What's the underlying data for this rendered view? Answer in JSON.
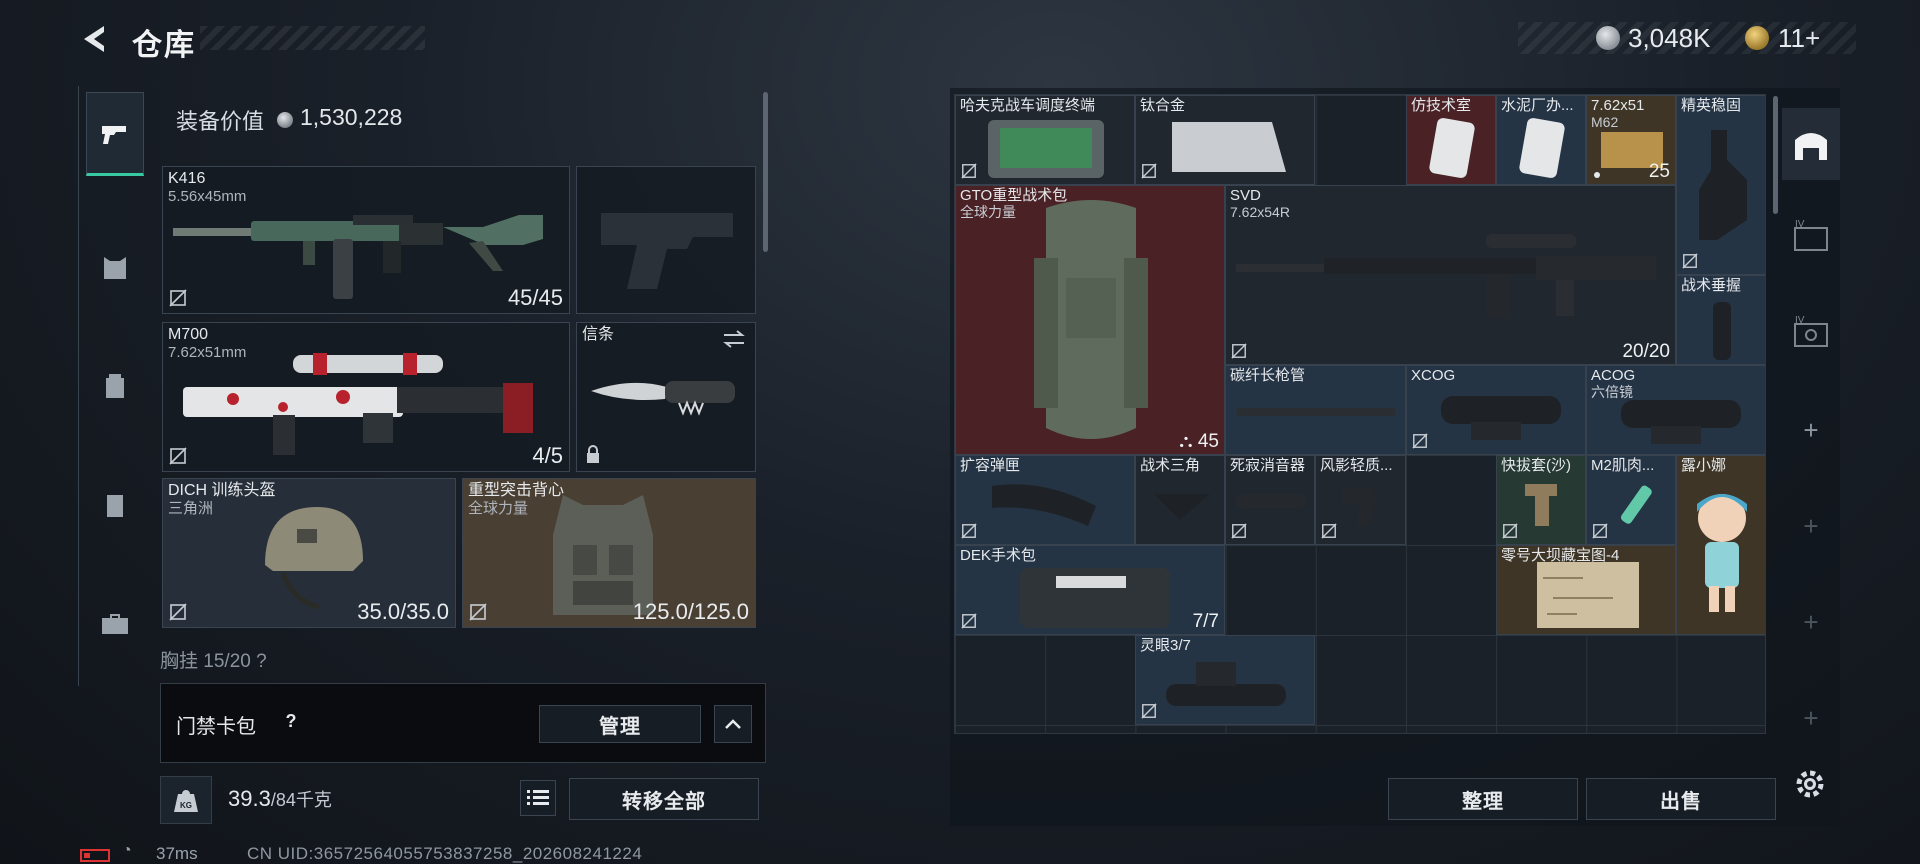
{
  "header": {
    "title": "仓库",
    "currency_main": "3,048K",
    "currency_premium": "11+"
  },
  "loadout": {
    "equip_value_label": "装备价值",
    "equip_value": "1,530,228",
    "slots": {
      "primary": {
        "name": "K416",
        "sub": "5.56x45mm",
        "count": "45/45"
      },
      "m700": {
        "name": "M700",
        "sub": "7.62x51mm",
        "count": "4/5"
      },
      "melee": {
        "name": "信条"
      },
      "helmet": {
        "name": "DICH 训练头盔",
        "sub": "三角洲",
        "count": "35.0/35.0"
      },
      "armor": {
        "name": "重型突击背心",
        "sub": "全球力量",
        "count": "125.0/125.0"
      }
    },
    "chest_label": "胸挂  15/20  ?"
  },
  "access_card": {
    "label": "门禁卡包",
    "help": "?",
    "manage": "管理"
  },
  "weight": {
    "current": "39.3",
    "max": "/84千克",
    "transfer": "转移全部"
  },
  "status": {
    "ping": "37ms",
    "uid": "CN UID:3657256405575383725​8_202608241224"
  },
  "storage": {
    "items": {
      "hafuke": {
        "name": "哈夫克战车调度终端"
      },
      "titanium": {
        "name": "钛合金"
      },
      "facsimile": {
        "name": "仿技术室"
      },
      "cement": {
        "name": "水泥厂办..."
      },
      "ammo": {
        "name": "7.62x51",
        "sub": "M62",
        "count": "25"
      },
      "stabilizer": {
        "name": "精英稳固"
      },
      "gto_pack": {
        "name": "GTO重型战术包",
        "sub": "全球力量",
        "count": "45"
      },
      "svd": {
        "name": "SVD",
        "sub": "7.62x54R",
        "count": "20/20"
      },
      "grip": {
        "name": "战术垂握"
      },
      "barrel": {
        "name": "碳纤长枪管"
      },
      "xcog": {
        "name": "XCOG"
      },
      "acog": {
        "name": "ACOG",
        "sub": "六倍镜"
      },
      "ext_mag": {
        "name": "扩容弹匣"
      },
      "tri_grip": {
        "name": "战术三角"
      },
      "silencer": {
        "name": "死寂消音器"
      },
      "wind_grip": {
        "name": "风影轻质..."
      },
      "holster": {
        "name": "快拔套(沙)"
      },
      "m2": {
        "name": "M2肌肉..."
      },
      "luxiaona": {
        "name": "露小娜"
      },
      "medkit": {
        "name": "DEK手术包",
        "count": "7/7"
      },
      "map": {
        "name": "零号大坝藏宝图-4"
      },
      "lingyan": {
        "name": "灵眼3/7"
      }
    },
    "sort": "整理",
    "sell": "出售"
  },
  "colors": {
    "accent": "#38c9a2",
    "rare_red": "#4a2226",
    "rare_blue": "#243445",
    "rare_gold": "#3e3526"
  }
}
